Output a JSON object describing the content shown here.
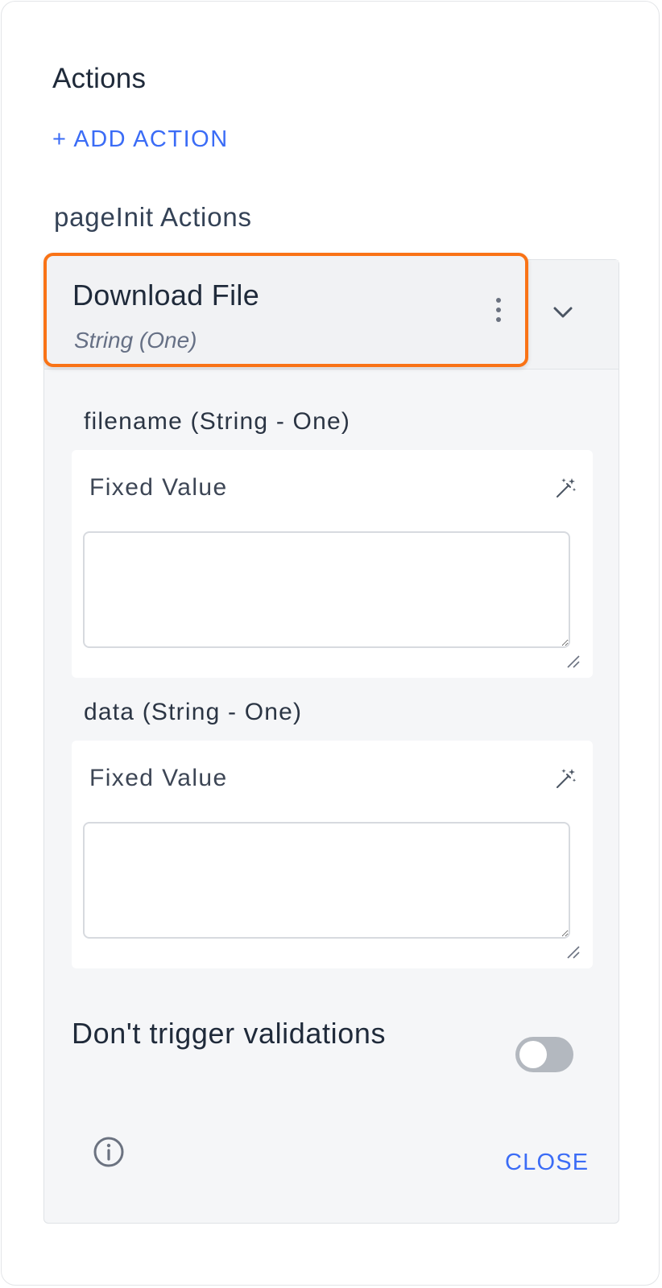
{
  "panel": {
    "heading": "Actions",
    "add_action_label": "+ ADD ACTION",
    "section_title": "pageInit Actions"
  },
  "action": {
    "title": "Download File",
    "subtitle": "String (One)"
  },
  "fields": [
    {
      "label": "filename (String - One)",
      "mode_label": "Fixed Value",
      "value": ""
    },
    {
      "label": "data (String - One)",
      "mode_label": "Fixed Value",
      "value": ""
    }
  ],
  "options": {
    "validation_toggle_label": "Don't trigger validations",
    "validation_toggle_on": false
  },
  "footer": {
    "close_label": "CLOSE"
  },
  "colors": {
    "accent": "#3b6cf6",
    "highlight": "#f97316"
  },
  "icons": [
    "kebab-menu-icon",
    "chevron-down-icon",
    "magic-wand-icon",
    "info-icon",
    "resize-grip-icon"
  ]
}
